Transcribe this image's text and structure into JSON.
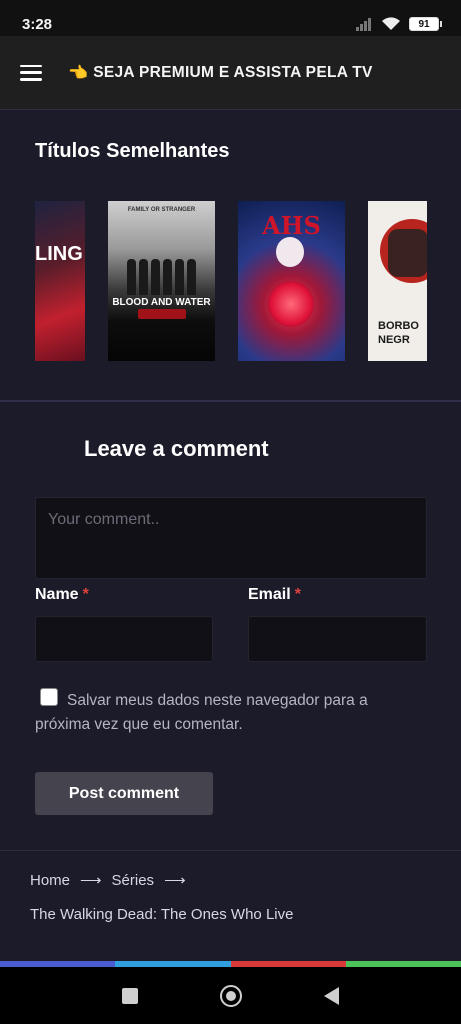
{
  "status": {
    "time": "3:28",
    "battery": "91"
  },
  "header": {
    "promo_icon": "pointing-hand-icon",
    "promo_text": "SEJA PREMIUM E ASSISTA PELA TV"
  },
  "similar": {
    "title": "Títulos Semelhantes",
    "posters": [
      {
        "label": "LING"
      },
      {
        "label": "BLOOD AND WATER",
        "tagline": "FAMILY OR STRANGER"
      },
      {
        "label": "AHS"
      },
      {
        "label": "BORBO NEGR"
      }
    ]
  },
  "comment": {
    "title": "Leave a comment",
    "placeholder": "Your comment..",
    "name_label": "Name",
    "email_label": "Email",
    "required_mark": "*",
    "save_label": "Salvar meus dados neste navegador para a próxima vez que eu comentar.",
    "submit_label": "Post comment"
  },
  "footer": {
    "breadcrumb": [
      "Home",
      "Séries"
    ],
    "arrow": "⟶",
    "current_title": "The Walking Dead: The Ones Who Live"
  },
  "colors": {
    "background": "#1c1b29",
    "strip": [
      "#4b5bd0",
      "#2f9fe0",
      "#d83a3a",
      "#4cc25a"
    ]
  }
}
